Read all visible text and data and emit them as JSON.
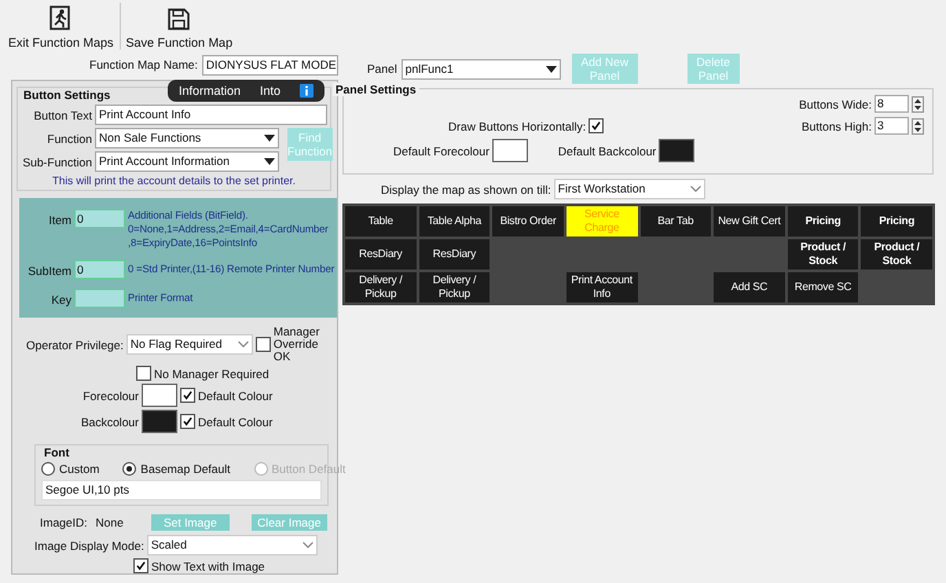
{
  "toolbar": [
    {
      "kind": "exit",
      "label": "Exit Function Maps"
    },
    {
      "kind": "save",
      "label": "Save Function Map"
    }
  ],
  "function_map_name": {
    "label": "Function Map Name:",
    "value": "DIONYSUS FLAT MODE"
  },
  "tooltip": {
    "items": [
      "Information",
      "Into"
    ]
  },
  "button_settings": {
    "title": "Button Settings",
    "button_text": {
      "label": "Button Text",
      "value": "Print Account Info"
    },
    "function": {
      "label": "Function",
      "value": "Non Sale Functions"
    },
    "sub_function": {
      "label": "Sub-Function",
      "value": "Print Account Information"
    },
    "find_button": "Find Function",
    "description": "This will print the account details to the set printer.",
    "fields": [
      {
        "label": "Item",
        "value": "0",
        "note": "Additional Fields (BitField). 0=None,1=Address,2=Email,4=CardNumber ,8=ExpiryDate,16=PointsInfo"
      },
      {
        "label": "SubItem",
        "value": "0",
        "note": "0 =Std Printer,(11-16) Remote Printer Number"
      },
      {
        "label": "Key",
        "note": "Printer Format"
      }
    ],
    "operator_privilege": {
      "label": "Operator Privilege:",
      "value": "No Flag Required"
    },
    "manager_override": {
      "label": "Manager Override OK",
      "checked": false
    },
    "no_manager_required": {
      "label": "No Manager Required",
      "checked": false
    },
    "colours": [
      {
        "label": "Forecolour",
        "color": "#ffffff",
        "default_label": "Default Colour",
        "checked": true
      },
      {
        "label": "Backcolour",
        "color": "#1c1c1c",
        "default_label": "Default Colour",
        "checked": true
      }
    ],
    "font": {
      "title": "Font",
      "options": [
        {
          "label": "Custom",
          "selected": false,
          "disabled": false
        },
        {
          "label": "Basemap Default",
          "selected": true,
          "disabled": false
        },
        {
          "label": "Button Default",
          "selected": false,
          "disabled": true
        }
      ],
      "value": "Segoe UI,10 pts"
    },
    "image_id": {
      "label": "ImageID:",
      "value": "None"
    },
    "set_image": "Set Image",
    "clear_image": "Clear Image",
    "image_display_mode": {
      "label": "Image Display Mode:",
      "value": "Scaled"
    },
    "show_text_with_image": {
      "label": "Show Text with Image",
      "checked": true
    }
  },
  "panel": {
    "label": "Panel",
    "value": "pnlFunc1"
  },
  "add_panel": "Add New Panel",
  "delete_panel": "Delete Panel",
  "panel_settings": {
    "title": "Panel Settings",
    "buttons_wide": {
      "label": "Buttons Wide:",
      "value": "8"
    },
    "draw_horizontally": {
      "label": "Draw Buttons Horizontally:",
      "checked": true
    },
    "buttons_high": {
      "label": "Buttons High:",
      "value": "3"
    },
    "default_forecolour": {
      "label": "Default Forecolour",
      "color": "#ffffff"
    },
    "default_backcolour": {
      "label": "Default Backcolour",
      "color": "#1c1c1c"
    }
  },
  "display_map": {
    "label": "Display the map as shown on till:",
    "value": "First Workstation"
  },
  "grid": {
    "cells": [
      {
        "kind": "button",
        "label": "Table",
        "bold": false,
        "selected": false
      },
      {
        "kind": "button",
        "label": "Table Alpha",
        "bold": false,
        "selected": false
      },
      {
        "kind": "button",
        "label": "Bistro Order",
        "bold": false,
        "selected": false
      },
      {
        "kind": "button",
        "label": "Service Charge",
        "bold": false,
        "selected": true
      },
      {
        "kind": "button",
        "label": "Bar Tab",
        "bold": false,
        "selected": false
      },
      {
        "kind": "button",
        "label": "New Gift Cert",
        "bold": false,
        "selected": false
      },
      {
        "kind": "button",
        "label": "Pricing",
        "bold": true,
        "selected": false
      },
      {
        "kind": "button",
        "label": "Pricing",
        "bold": true,
        "selected": false
      },
      {
        "kind": "button",
        "label": "ResDiary",
        "bold": false,
        "selected": false
      },
      {
        "kind": "button",
        "label": "ResDiary",
        "bold": false,
        "selected": false
      },
      {
        "kind": "empty"
      },
      {
        "kind": "empty"
      },
      {
        "kind": "empty"
      },
      {
        "kind": "empty"
      },
      {
        "kind": "button",
        "label": "Product / Stock",
        "bold": true,
        "selected": false
      },
      {
        "kind": "button",
        "label": "Product / Stock",
        "bold": true,
        "selected": false
      },
      {
        "kind": "button",
        "label": "Delivery / Pickup",
        "bold": false,
        "selected": false
      },
      {
        "kind": "button",
        "label": "Delivery / Pickup",
        "bold": false,
        "selected": false
      },
      {
        "kind": "empty"
      },
      {
        "kind": "button",
        "label": "Print Account Info",
        "bold": false,
        "selected": false
      },
      {
        "kind": "empty"
      },
      {
        "kind": "button",
        "label": "Add SC",
        "bold": false,
        "selected": false
      },
      {
        "kind": "button",
        "label": "Remove SC",
        "bold": false,
        "selected": false
      },
      {
        "kind": "empty"
      }
    ]
  }
}
